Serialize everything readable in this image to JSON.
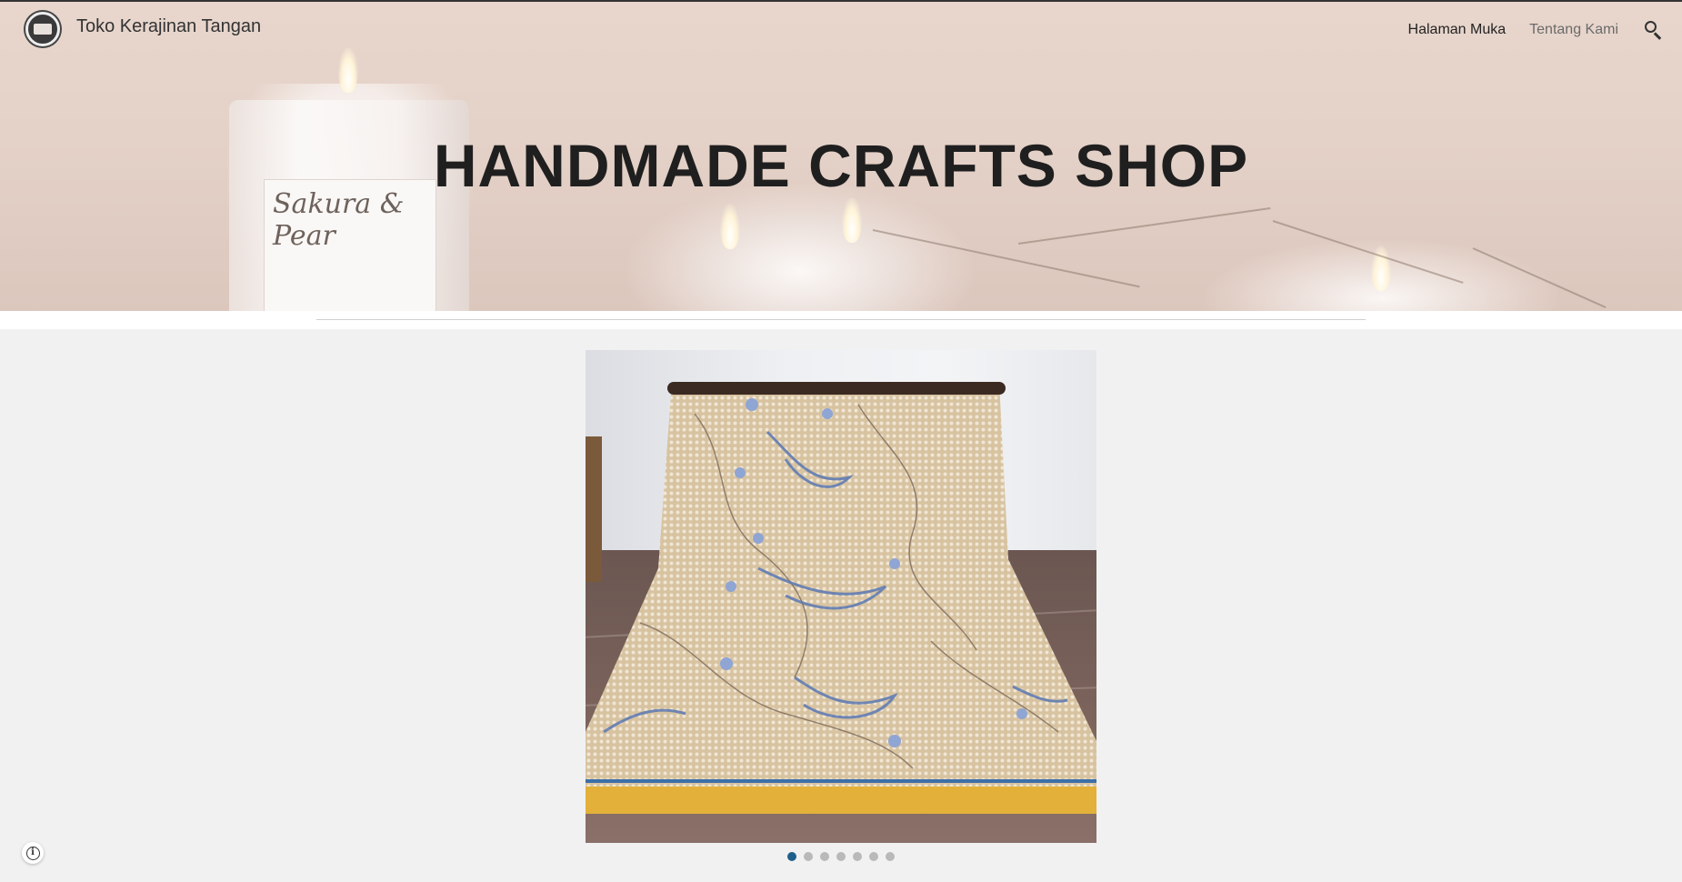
{
  "site": {
    "title": "Toko Kerajinan Tangan",
    "logo_icon": "shop-logo-icon"
  },
  "nav": {
    "items": [
      {
        "label": "Halaman Muka",
        "active": true
      },
      {
        "label": "Tentang Kami",
        "active": false
      }
    ],
    "search_icon": "search-icon"
  },
  "hero": {
    "title": "HANDMADE CRAFTS SHOP",
    "candle_label": "Sakura & Pear"
  },
  "carousel": {
    "slide_count": 7,
    "active_index": 0,
    "image_description_icon": "batik-cloth-image"
  },
  "footer": {
    "info_icon": "info-icon"
  },
  "colors": {
    "accent_dot": "#1f5f8b",
    "background": "#f1f1f1",
    "hero_tint": "#e4d1c7"
  }
}
